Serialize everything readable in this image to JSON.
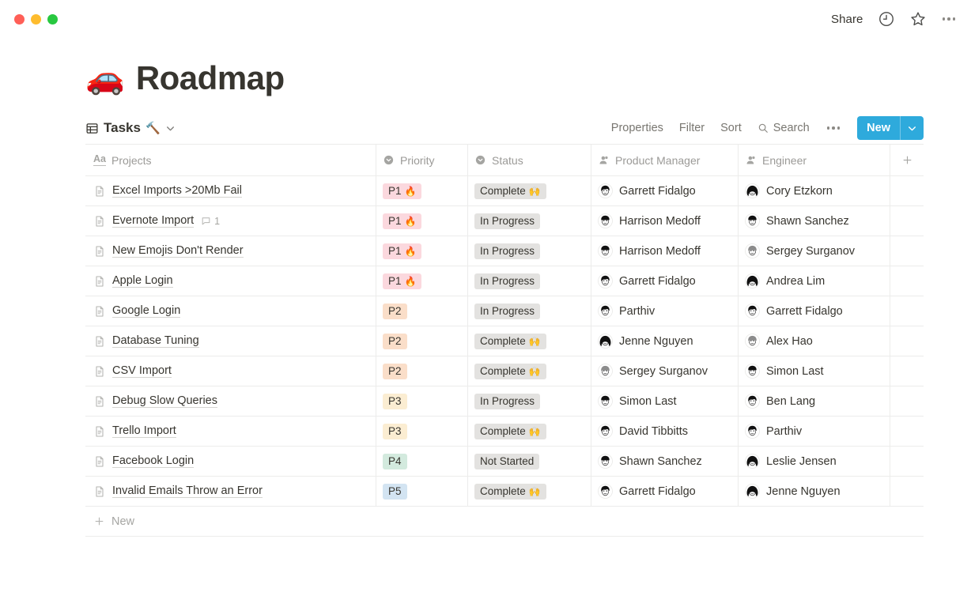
{
  "window": {
    "traffic_lights": [
      "close",
      "minimize",
      "maximize"
    ],
    "share_label": "Share",
    "icons": [
      "history-clock-icon",
      "star-icon",
      "more-options-icon"
    ]
  },
  "page": {
    "emoji": "🚗",
    "title": "Roadmap"
  },
  "view_bar": {
    "view_name": "Tasks",
    "view_emoji": "🔨",
    "properties_label": "Properties",
    "filter_label": "Filter",
    "sort_label": "Sort",
    "search_label": "Search",
    "new_label": "New"
  },
  "table": {
    "columns": [
      {
        "label": "Projects",
        "icon": "title-text-icon"
      },
      {
        "label": "Priority",
        "icon": "select-icon"
      },
      {
        "label": "Status",
        "icon": "select-icon"
      },
      {
        "label": "Product Manager",
        "icon": "person-icon"
      },
      {
        "label": "Engineer",
        "icon": "person-icon"
      }
    ],
    "add_column_icon": "plus-icon",
    "new_row_label": "New",
    "priority_colors": {
      "P1": "#fbd8de",
      "P2": "#fadec9",
      "P3": "#fbedd2",
      "P4": "#d3eade",
      "P5": "#d3e4f2"
    },
    "status_color": "#e3e2e0",
    "rows": [
      {
        "project": "Excel Imports >20Mb Fail",
        "comments": null,
        "priority": "P1",
        "priority_emoji": "🔥",
        "status": "Complete",
        "status_emoji": "🙌",
        "product_manager": "Garrett Fidalgo",
        "engineer": "Cory Etzkorn"
      },
      {
        "project": "Evernote Import",
        "comments": "1",
        "priority": "P1",
        "priority_emoji": "🔥",
        "status": "In Progress",
        "status_emoji": "",
        "product_manager": "Harrison Medoff",
        "engineer": "Shawn Sanchez"
      },
      {
        "project": "New Emojis Don't Render",
        "comments": null,
        "priority": "P1",
        "priority_emoji": "🔥",
        "status": "In Progress",
        "status_emoji": "",
        "product_manager": "Harrison Medoff",
        "engineer": "Sergey Surganov"
      },
      {
        "project": "Apple Login",
        "comments": null,
        "priority": "P1",
        "priority_emoji": "🔥",
        "status": "In Progress",
        "status_emoji": "",
        "product_manager": "Garrett Fidalgo",
        "engineer": "Andrea Lim"
      },
      {
        "project": "Google Login",
        "comments": null,
        "priority": "P2",
        "priority_emoji": "",
        "status": "In Progress",
        "status_emoji": "",
        "product_manager": "Parthiv",
        "engineer": "Garrett Fidalgo"
      },
      {
        "project": "Database Tuning",
        "comments": null,
        "priority": "P2",
        "priority_emoji": "",
        "status": "Complete",
        "status_emoji": "🙌",
        "product_manager": "Jenne Nguyen",
        "engineer": "Alex Hao"
      },
      {
        "project": "CSV Import",
        "comments": null,
        "priority": "P2",
        "priority_emoji": "",
        "status": "Complete",
        "status_emoji": "🙌",
        "product_manager": "Sergey Surganov",
        "engineer": "Simon Last"
      },
      {
        "project": "Debug Slow Queries",
        "comments": null,
        "priority": "P3",
        "priority_emoji": "",
        "status": "In Progress",
        "status_emoji": "",
        "product_manager": "Simon Last",
        "engineer": "Ben Lang"
      },
      {
        "project": "Trello Import",
        "comments": null,
        "priority": "P3",
        "priority_emoji": "",
        "status": "Complete",
        "status_emoji": "🙌",
        "product_manager": "David Tibbitts",
        "engineer": "Parthiv"
      },
      {
        "project": "Facebook Login",
        "comments": null,
        "priority": "P4",
        "priority_emoji": "",
        "status": "Not Started",
        "status_emoji": "",
        "product_manager": "Shawn Sanchez",
        "engineer": "Leslie Jensen"
      },
      {
        "project": "Invalid Emails Throw an Error",
        "comments": null,
        "priority": "P5",
        "priority_emoji": "",
        "status": "Complete",
        "status_emoji": "🙌",
        "product_manager": "Garrett Fidalgo",
        "engineer": "Jenne Nguyen"
      }
    ]
  }
}
